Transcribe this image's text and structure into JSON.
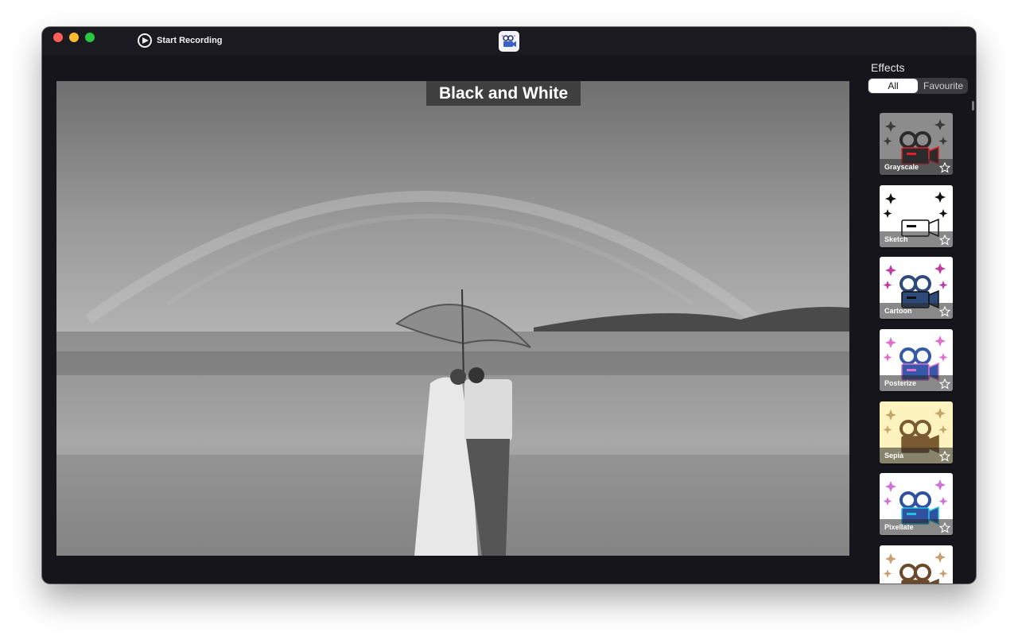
{
  "toolbar": {
    "record_label": "Start Recording",
    "app_icon": "camera-app-icon"
  },
  "preview": {
    "filter_title": "Black and White"
  },
  "effects_panel": {
    "title": "Effects",
    "tabs": [
      {
        "label": "All",
        "active": true
      },
      {
        "label": "Favourite",
        "active": false
      }
    ],
    "items": [
      {
        "label": "Grayscale",
        "bg": "#8c8c8c",
        "cam": "#2b2b2b",
        "spark": "#3a3a3a",
        "accent": "#e01e2d"
      },
      {
        "label": "Sketch",
        "bg": "#ffffff",
        "cam": "#ffffff",
        "spark": "#111111",
        "accent": "#111111"
      },
      {
        "label": "Cartoon",
        "bg": "#ffffff",
        "cam": "#2e4a78",
        "spark": "#c03aa0",
        "accent": "#111111"
      },
      {
        "label": "Posterize",
        "bg": "#ffffff",
        "cam": "#3558a8",
        "spark": "#e070d0",
        "accent": "#e070d0"
      },
      {
        "label": "Sepia",
        "bg": "#fdf3bf",
        "cam": "#7a5a30",
        "spark": "#c8a86a",
        "accent": "#7a5a30"
      },
      {
        "label": "Pixellate",
        "bg": "#ffffff",
        "cam": "#3050a0",
        "spark": "#d070d8",
        "accent": "#20c0e0"
      },
      {
        "label": "",
        "bg": "#ffffff",
        "cam": "#6a4a2a",
        "spark": "#c8a070",
        "accent": "#6a4a2a"
      }
    ]
  }
}
